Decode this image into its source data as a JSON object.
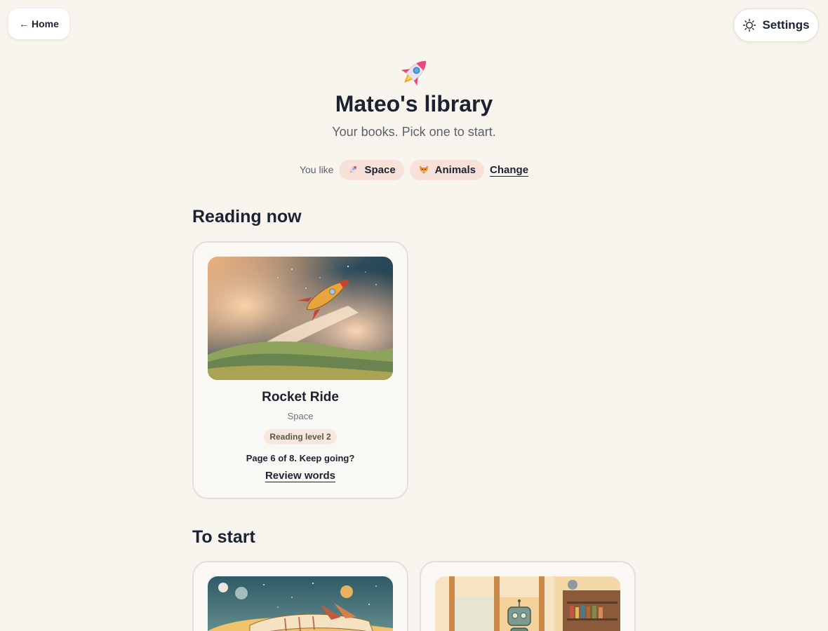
{
  "nav": {
    "home_label": "← Home",
    "settings_label": "Settings"
  },
  "header": {
    "icon": "rocket-emoji",
    "title": "Mateo's library",
    "subtitle": "Your books. Pick one to start."
  },
  "preferences": {
    "label": "You like",
    "chips": [
      {
        "label": "Space",
        "icon": "rocket-icon"
      },
      {
        "label": "Animals",
        "icon": "fox-icon"
      }
    ],
    "change_label": "Change"
  },
  "reading_now": {
    "title": "Reading now",
    "books": [
      {
        "title": "Rocket Ride",
        "category": "Space",
        "level": "Reading level 2",
        "progress_text": "Page 6 of 8. Keep going?",
        "current_page": 6,
        "total_pages": 8,
        "review_label": "Review words",
        "cover": "watercolor rocket over hills"
      }
    ]
  },
  "to_start": {
    "title": "To start",
    "books": [
      {
        "cover": "watercolor spaceship among planets"
      },
      {
        "cover": "watercolor robot by a window with bookshelf"
      }
    ]
  },
  "colors": {
    "background": "#f8f5ef",
    "chip": "#f7e1d9",
    "text": "#1c2230",
    "muted": "#5e6068"
  }
}
